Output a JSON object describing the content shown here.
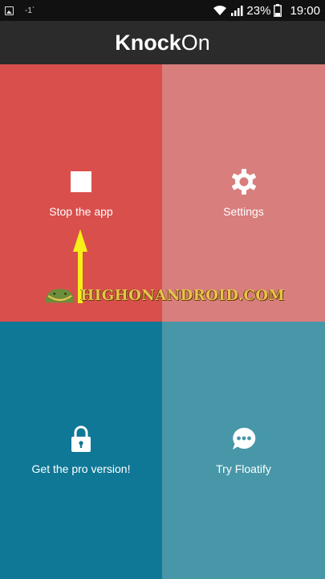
{
  "status_bar": {
    "notif_label": "-1`",
    "battery": "23%",
    "time": "19:00"
  },
  "app_bar": {
    "title_bold": "Knock",
    "title_light": "On"
  },
  "tiles": [
    {
      "label": "Stop the app",
      "icon": "stop-icon",
      "color": "#d94f4c"
    },
    {
      "label": "Settings",
      "icon": "gear-icon",
      "color": "#d87e7d"
    },
    {
      "label": "Get the pro version!",
      "icon": "lock-icon",
      "color": "#0f7896"
    },
    {
      "label": "Try Floatify",
      "icon": "chat-bubble-icon",
      "color": "#4797a8"
    }
  ],
  "watermark": {
    "text": "HIGHONANDROID.COM"
  }
}
